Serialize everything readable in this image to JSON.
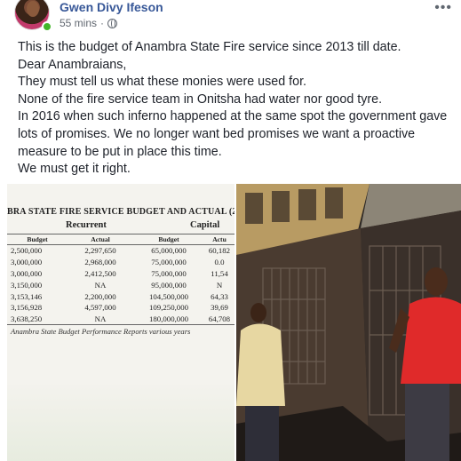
{
  "post": {
    "author": "Gwen Divy Ifeson",
    "time": "55 mins",
    "separator": "·",
    "more_label": "•••",
    "lines": [
      "This is the budget of Anambra State Fire service since 2013 till date.",
      "Dear Anambraians,",
      "They must tell us what these monies were used for.",
      "None of the fire service team in Onitsha had water nor good tyre.",
      "In 2016 when such inferno happened at the same spot the government gave",
      "lots of promises. We no longer want bed promises we want a proactive",
      "measure to be put in place this time.",
      "We must get it right."
    ]
  },
  "budget_image": {
    "title": "BRA STATE FIRE SERVICE BUDGET AND ACTUAL (20",
    "group_recurrent": "Recurrent",
    "group_capital": "Capital",
    "headers": [
      "Budget",
      "Actual",
      "Budget",
      "Actu"
    ],
    "rows": [
      [
        "2,500,000",
        "2,297,650",
        "65,000,000",
        "60,182"
      ],
      [
        "3,000,000",
        "2,968,000",
        "75,000,000",
        "0.0"
      ],
      [
        "3,000,000",
        "2,412,500",
        "75,000,000",
        "11,54"
      ],
      [
        "3,150,000",
        "NA",
        "95,000,000",
        "N"
      ],
      [
        "3,153,146",
        "2,200,000",
        "104,500,000",
        "64,33"
      ],
      [
        "3,156,928",
        "4,597,000",
        "109,250,000",
        "39,69"
      ],
      [
        "3,638,250",
        "NA",
        "180,000,000",
        "64,708"
      ]
    ],
    "source": "Anambra State Budget Performance Reports various years"
  },
  "colors": {
    "author_link": "#385898",
    "online": "#42b72a",
    "text": "#1d2129",
    "meta": "#616770"
  }
}
